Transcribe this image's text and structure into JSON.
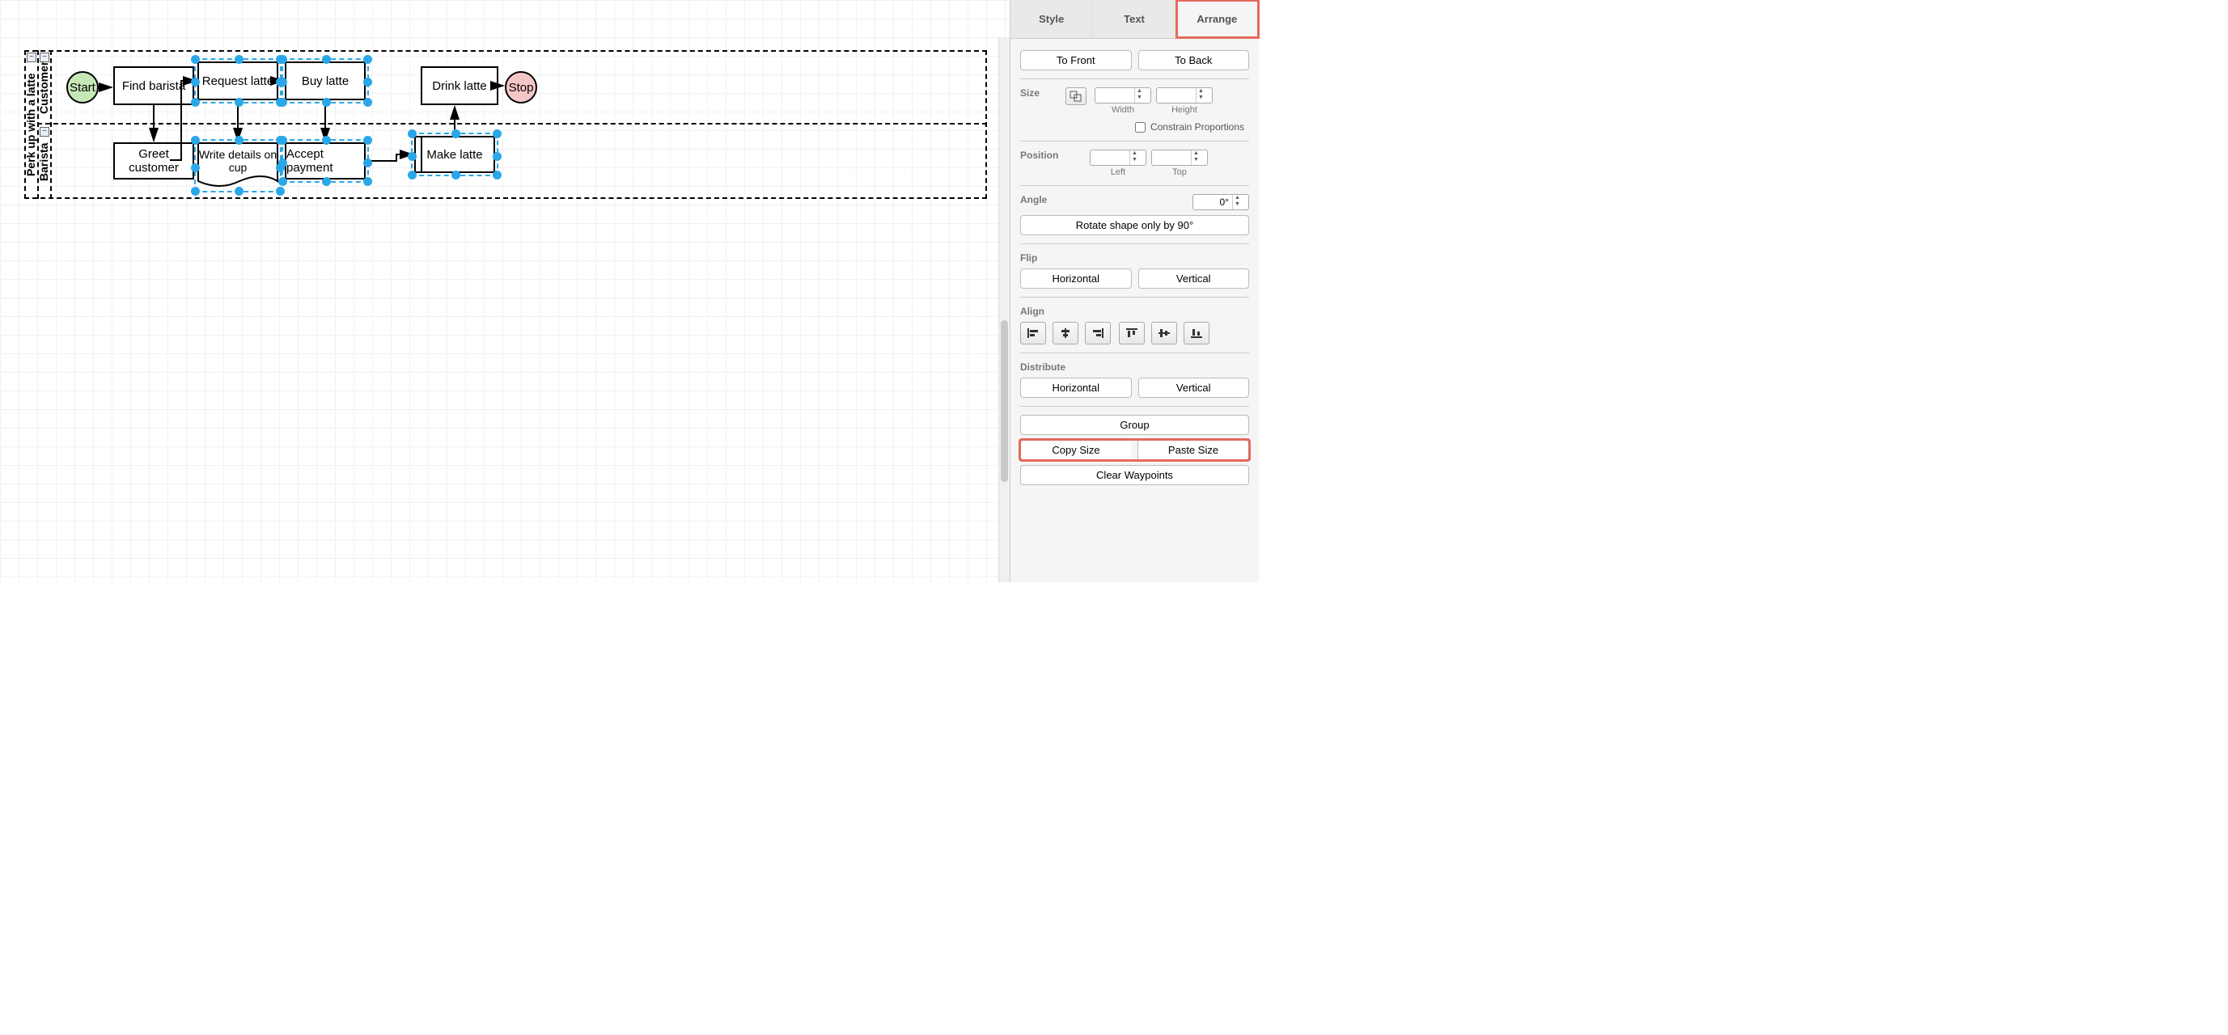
{
  "tabs": {
    "style": "Style",
    "text": "Text",
    "arrange": "Arrange"
  },
  "arrange": {
    "to_front": "To Front",
    "to_back": "To Back",
    "size_label": "Size",
    "width": "Width",
    "height": "Height",
    "constrain": "Constrain Proportions",
    "position_label": "Position",
    "left": "Left",
    "top": "Top",
    "angle_label": "Angle",
    "angle_value": "0°",
    "rotate90": "Rotate shape only by 90°",
    "flip_label": "Flip",
    "horizontal": "Horizontal",
    "vertical": "Vertical",
    "align_label": "Align",
    "distribute_label": "Distribute",
    "group": "Group",
    "copy_size": "Copy Size",
    "paste_size": "Paste Size",
    "clear_waypoints": "Clear Waypoints"
  },
  "diagram": {
    "pool": "Perk up with a latte",
    "lane_customer": "Customer",
    "lane_barista": "Barista",
    "start": "Start",
    "find_barista": "Find barista",
    "request_latte": "Request latte",
    "buy_latte": "Buy latte",
    "drink_latte": "Drink latte",
    "stop": "Stop",
    "greet_customer": "Greet customer",
    "write_details": "Write details on cup",
    "accept_payment": "Accept payment",
    "make_latte": "Make latte"
  }
}
